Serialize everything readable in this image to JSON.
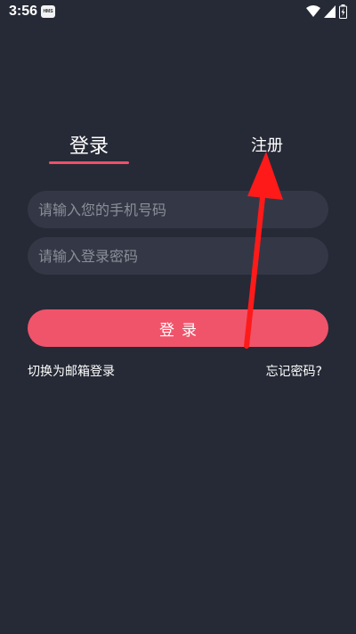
{
  "status_bar": {
    "time": "3:56",
    "badge": "HMS",
    "icons": [
      "wifi-icon",
      "signal-icon",
      "battery-icon"
    ]
  },
  "tabs": {
    "login": "登录",
    "register": "注册"
  },
  "form": {
    "phone_placeholder": "请输入您的手机号码",
    "password_placeholder": "请输入登录密码",
    "submit_label": "登录"
  },
  "links": {
    "switch_email": "切换为邮箱登录",
    "forgot_password": "忘记密码?"
  },
  "colors": {
    "background": "#262a36",
    "input_background": "#343846",
    "accent": "#f0546a",
    "annotation_arrow": "#ff0000"
  }
}
